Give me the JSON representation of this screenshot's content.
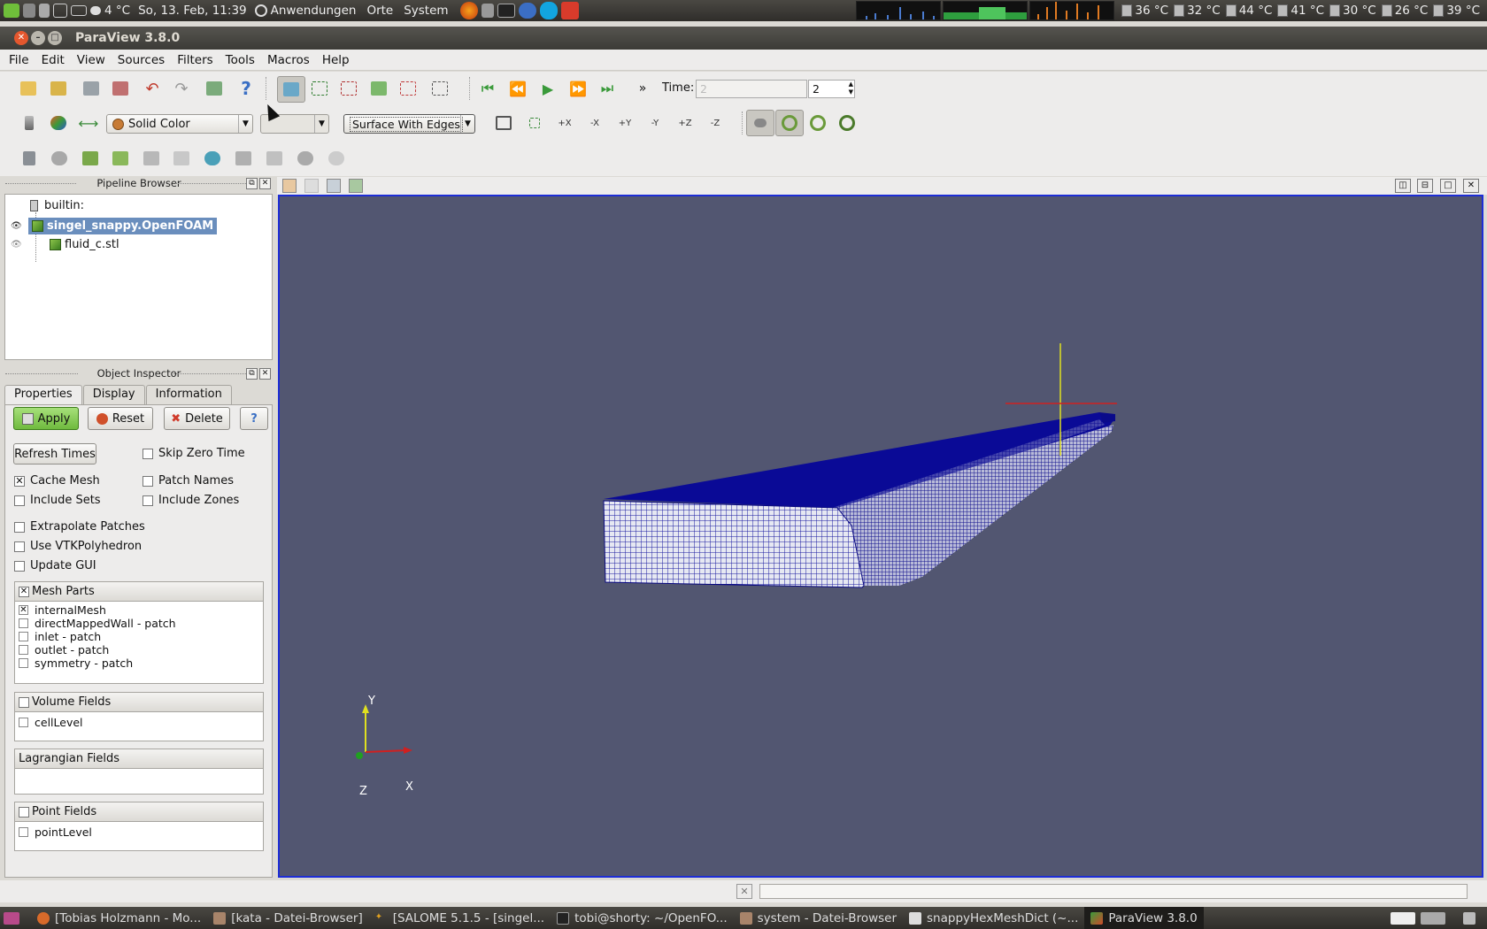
{
  "top_panel": {
    "weather": "4 °C",
    "clock": "So, 13. Feb, 11:39",
    "menus": [
      "Anwendungen",
      "Orte",
      "System"
    ],
    "temps": [
      "36 °C",
      "32 °C",
      "44 °C",
      "41 °C",
      "30 °C",
      "26 °C",
      "39 °C"
    ]
  },
  "window": {
    "title": "ParaView 3.8.0"
  },
  "menubar": [
    "File",
    "Edit",
    "View",
    "Sources",
    "Filters",
    "Tools",
    "Macros",
    "Help"
  ],
  "toolbar": {
    "time_label": "Time:",
    "time_value": "2",
    "time_step": "2",
    "color_by": "Solid Color",
    "representation": "Surface With Edges",
    "more": "»"
  },
  "pipeline_browser": {
    "title": "Pipeline Browser",
    "items": [
      {
        "label": "builtin:"
      },
      {
        "label": "singel_snappy.OpenFOAM"
      },
      {
        "label": "fluid_c.stl"
      }
    ]
  },
  "object_inspector": {
    "title": "Object Inspector",
    "tabs": [
      "Properties",
      "Display",
      "Information"
    ],
    "apply": "Apply",
    "reset": "Reset",
    "delete": "Delete",
    "help": "?",
    "refresh_times": "Refresh Times",
    "checkboxes": {
      "skip_zero_time": "Skip Zero Time",
      "cache_mesh": "Cache Mesh",
      "patch_names": "Patch Names",
      "include_sets": "Include Sets",
      "include_zones": "Include Zones",
      "extrapolate_patches": "Extrapolate Patches",
      "use_vtkpolyhedron": "Use VTKPolyhedron",
      "update_gui": "Update GUI"
    },
    "mesh_parts": {
      "title": "Mesh Parts",
      "items": [
        "internalMesh",
        "directMappedWall - patch",
        "inlet - patch",
        "outlet - patch",
        "symmetry - patch"
      ]
    },
    "volume_fields": {
      "title": "Volume Fields",
      "items": [
        "cellLevel"
      ]
    },
    "lagrangian_fields": {
      "title": "Lagrangian Fields"
    },
    "point_fields": {
      "title": "Point Fields",
      "items": [
        "pointLevel"
      ]
    }
  },
  "viewport": {
    "background": "#525671",
    "mesh_color": "#0b0b9a",
    "axes": {
      "x": "X",
      "y": "Y",
      "z": "Z"
    }
  },
  "taskbar": [
    "[Tobias Holzmann - Mo...",
    "[kata - Datei-Browser]",
    "[SALOME 5.1.5 - [singel...",
    "tobi@shorty: ~/OpenFO...",
    "system - Datei-Browser",
    "snappyHexMeshDict (~...",
    "ParaView 3.8.0"
  ]
}
